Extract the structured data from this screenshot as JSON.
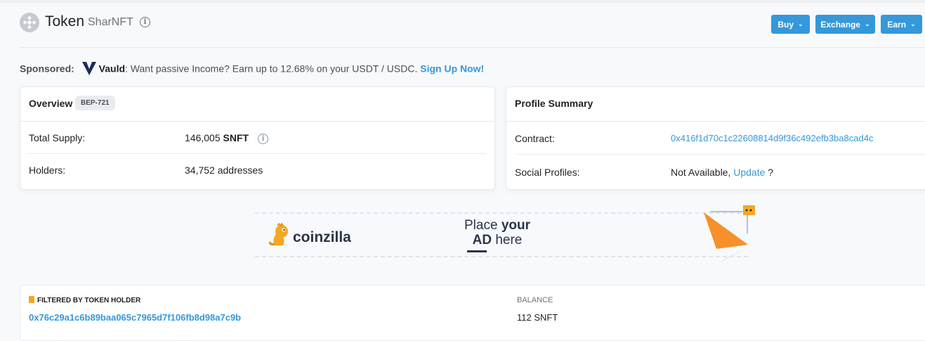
{
  "header": {
    "title": "Token",
    "subtitle": "SharNFT",
    "buttons": [
      {
        "label": "Buy"
      },
      {
        "label": "Exchange"
      },
      {
        "label": "Earn"
      }
    ]
  },
  "sponsored": {
    "label": "Sponsored:",
    "brand": "Vauld",
    "text": ": Want passive Income? Earn up to 12.68% on your USDT / USDC.",
    "cta": "Sign Up Now!"
  },
  "overview": {
    "title": "Overview",
    "badge": "BEP-721",
    "rows": [
      {
        "label": "Total Supply:",
        "value": "146,005",
        "unit": "SNFT"
      },
      {
        "label": "Holders:",
        "value": "34,752 addresses"
      }
    ]
  },
  "profile": {
    "title": "Profile Summary",
    "contract_label": "Contract:",
    "contract_value": "0x416f1d70c1c22608814d9f36c492efb3ba8cad4c",
    "social_label": "Social Profiles:",
    "social_value": "Not Available,",
    "social_link": "Update",
    "social_suffix": "?"
  },
  "ad": {
    "brand": "coinzilla",
    "line1_a": "Place ",
    "line1_b": "your",
    "line2_a": "AD",
    "line2_b": " here"
  },
  "filter": {
    "label": "FILTERED BY TOKEN HOLDER",
    "address": "0x76c29a1c6b89baa065c7965d7f106fb8d98a7c9b",
    "balance_label": "BALANCE",
    "balance_value": "112 SNFT"
  },
  "colors": {
    "accent": "#3498db",
    "text": "#1e2022",
    "muted": "#6c757e"
  }
}
